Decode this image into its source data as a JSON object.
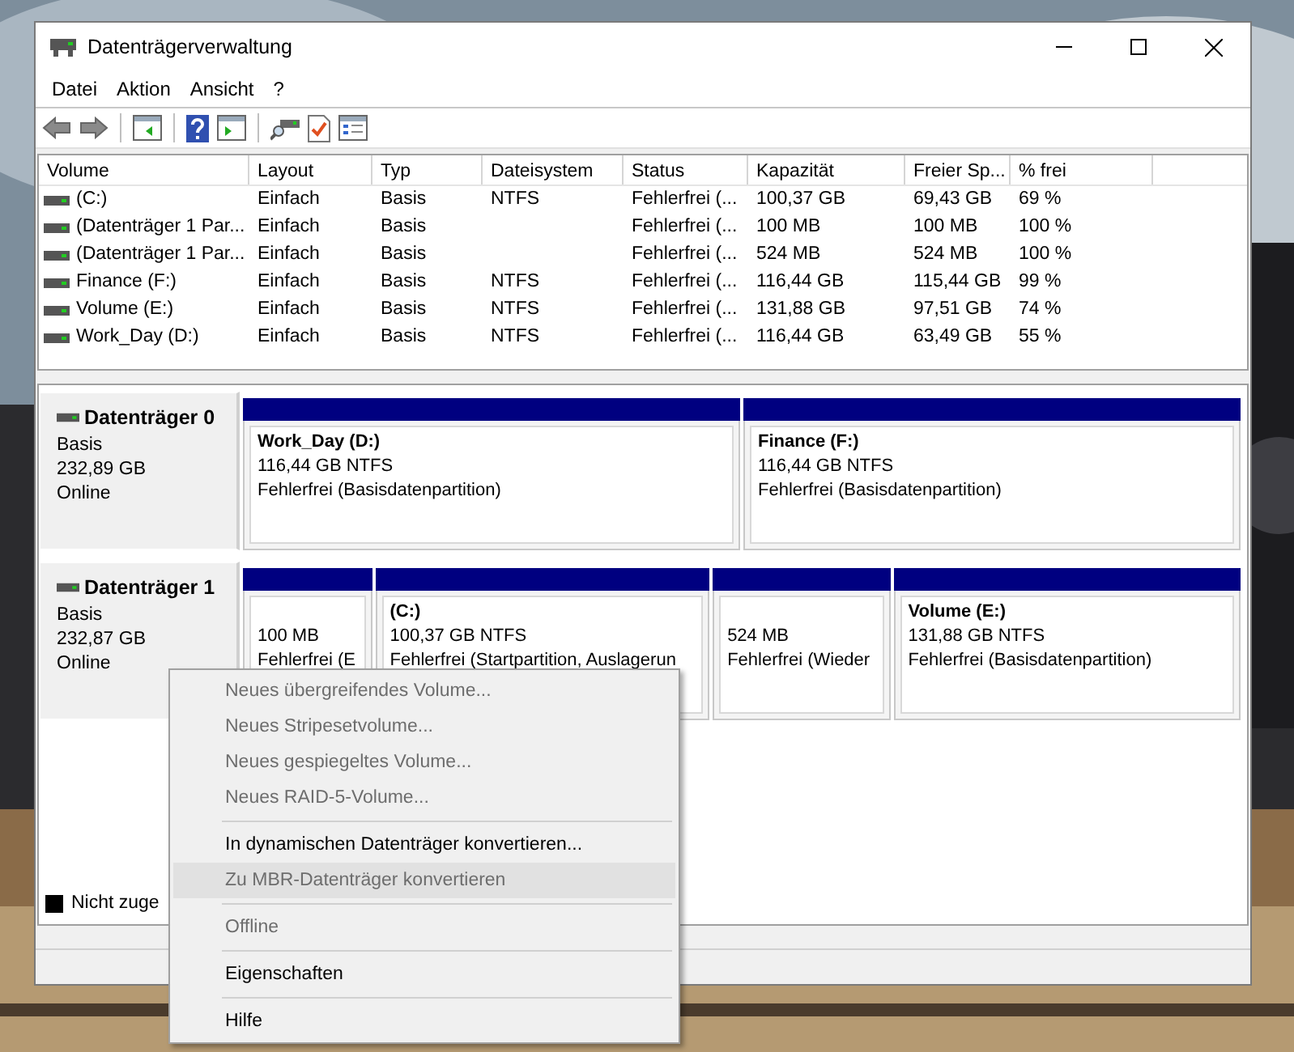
{
  "window": {
    "title": "Datenträgerverwaltung"
  },
  "menu_bar": [
    "Datei",
    "Aktion",
    "Ansicht",
    "?"
  ],
  "volume_table": {
    "columns": [
      "Volume",
      "Layout",
      "Typ",
      "Dateisystem",
      "Status",
      "Kapazität",
      "Freier Sp...",
      "% frei"
    ],
    "rows": [
      [
        "(C:)",
        "Einfach",
        "Basis",
        "NTFS",
        "Fehlerfrei (...",
        "100,37 GB",
        "69,43 GB",
        "69 %"
      ],
      [
        "(Datenträger 1 Par...",
        "Einfach",
        "Basis",
        "",
        "Fehlerfrei (...",
        "100 MB",
        "100 MB",
        "100 %"
      ],
      [
        "(Datenträger 1 Par...",
        "Einfach",
        "Basis",
        "",
        "Fehlerfrei (...",
        "524 MB",
        "524 MB",
        "100 %"
      ],
      [
        "Finance (F:)",
        "Einfach",
        "Basis",
        "NTFS",
        "Fehlerfrei (...",
        "116,44 GB",
        "115,44 GB",
        "99 %"
      ],
      [
        "Volume (E:)",
        "Einfach",
        "Basis",
        "NTFS",
        "Fehlerfrei (...",
        "131,88 GB",
        "97,51 GB",
        "74 %"
      ],
      [
        "Work_Day (D:)",
        "Einfach",
        "Basis",
        "NTFS",
        "Fehlerfrei (...",
        "116,44 GB",
        "63,49 GB",
        "55 %"
      ]
    ]
  },
  "disks": [
    {
      "name": "Datenträger 0",
      "type": "Basis",
      "size": "232,89 GB",
      "status": "Online",
      "partitions": [
        {
          "title": "Work_Day  (D:)",
          "size_fs": "116,44 GB NTFS",
          "status": "Fehlerfrei (Basisdatenpartition)"
        },
        {
          "title": "Finance  (F:)",
          "size_fs": "116,44 GB NTFS",
          "status": "Fehlerfrei (Basisdatenpartition)"
        }
      ]
    },
    {
      "name": "Datenträger 1",
      "type": "Basis",
      "size": "232,87 GB",
      "status": "Online",
      "partitions": [
        {
          "size_fs": "100 MB",
          "status": "Fehlerfrei (E"
        },
        {
          "title": "(C:)",
          "size_fs": "100,37 GB NTFS",
          "status": "Fehlerfrei (Startpartition, Auslagerun"
        },
        {
          "size_fs": "524 MB",
          "status": "Fehlerfrei (Wieder"
        },
        {
          "title": "Volume  (E:)",
          "size_fs": "131,88 GB NTFS",
          "status": "Fehlerfrei (Basisdatenpartition)"
        }
      ]
    }
  ],
  "legend": [
    {
      "label": "Nicht zuge",
      "color": "#000000"
    }
  ],
  "context_menu": [
    {
      "kind": "item",
      "label": "Neues übergreifendes Volume...",
      "disabled": true,
      "selected": false
    },
    {
      "kind": "item",
      "label": "Neues Stripesetvolume...",
      "disabled": true,
      "selected": false
    },
    {
      "kind": "item",
      "label": "Neues gespiegeltes Volume...",
      "disabled": true,
      "selected": false
    },
    {
      "kind": "item",
      "label": "Neues RAID-5-Volume...",
      "disabled": true,
      "selected": false
    },
    {
      "kind": "separator"
    },
    {
      "kind": "item",
      "label": "In dynamischen Datenträger konvertieren...",
      "disabled": false,
      "selected": false
    },
    {
      "kind": "item",
      "label": "Zu MBR-Datenträger konvertieren",
      "disabled": true,
      "selected": true
    },
    {
      "kind": "separator"
    },
    {
      "kind": "item",
      "label": "Offline",
      "disabled": true,
      "selected": false
    },
    {
      "kind": "separator"
    },
    {
      "kind": "item",
      "label": "Eigenschaften",
      "disabled": false,
      "selected": false
    },
    {
      "kind": "separator"
    },
    {
      "kind": "item",
      "label": "Hilfe",
      "disabled": false,
      "selected": false
    }
  ]
}
